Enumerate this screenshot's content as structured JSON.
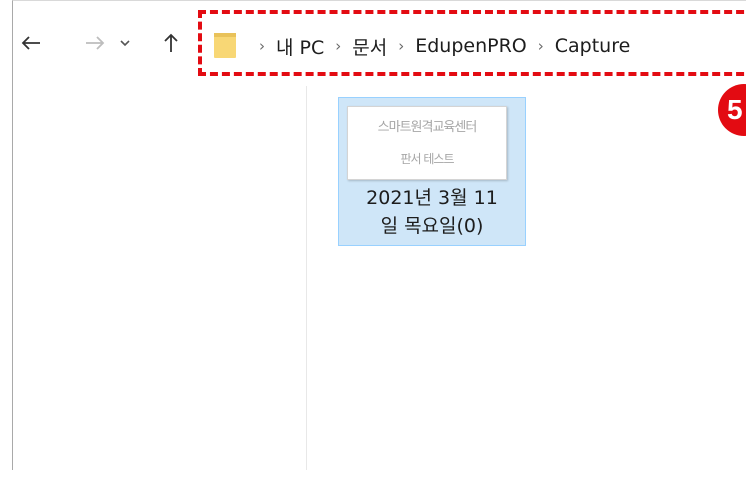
{
  "address_bar": {
    "breadcrumbs": [
      "내 PC",
      "문서",
      "EdupenPRO",
      "Capture"
    ],
    "separator": "›"
  },
  "nav": {
    "back_icon": "←",
    "forward_icon": "→",
    "recent_icon": "⌄",
    "up_icon": "↑"
  },
  "annotation": {
    "step_number": "5",
    "color": "#e30b12"
  },
  "files": [
    {
      "name_line1": "2021년 3월 11",
      "name_line2": "일 목요일(0)",
      "thumbnail_line1": "스마트원격교육센터",
      "thumbnail_line2": "판서 테스트",
      "selected": true
    }
  ],
  "colors": {
    "selection_bg": "#cfe6f8",
    "selection_border": "#99d1ff",
    "folder_icon": "#f8d775"
  }
}
